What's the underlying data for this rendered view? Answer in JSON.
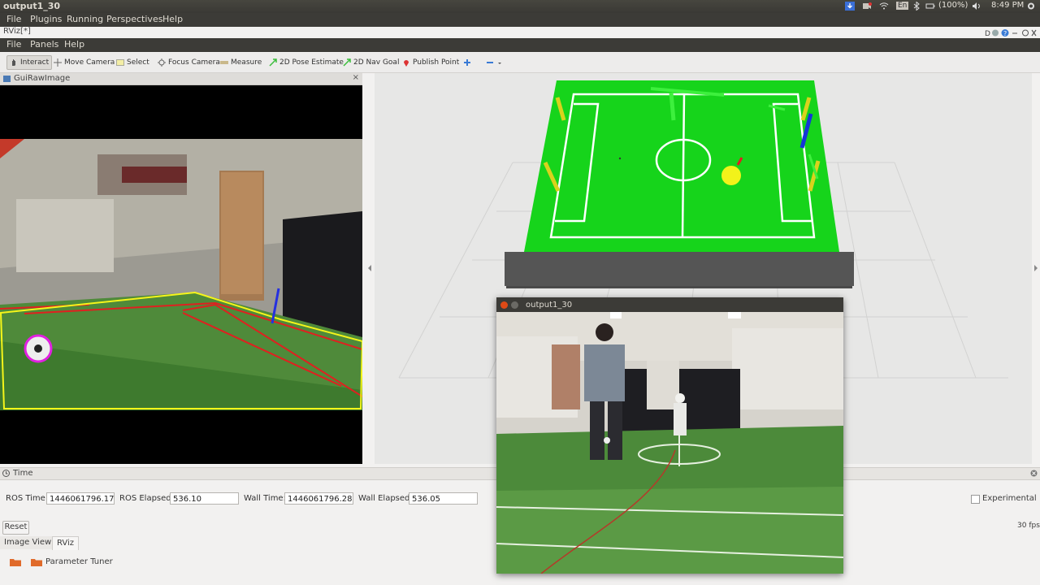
{
  "topbar": {
    "window_title": "output1_30",
    "keyboard_layout": "En",
    "battery": "(100%)",
    "clock": "8:49 PM"
  },
  "appmenu": [
    "File",
    "Plugins",
    "Running",
    "Perspectives",
    "Help"
  ],
  "rviz": {
    "title": "RViz[*]",
    "menu": [
      "File",
      "Panels",
      "Help"
    ],
    "toolbar": {
      "interact": "Interact",
      "move_camera": "Move Camera",
      "select": "Select",
      "focus_camera": "Focus Camera",
      "measure": "Measure",
      "pose_estimate": "2D Pose Estimate",
      "nav_goal": "2D Nav Goal",
      "publish_point": "Publish Point"
    }
  },
  "gui_panel": {
    "title": "GuiRawImage",
    "close": "×"
  },
  "time_panel": {
    "title": "Time",
    "ros_time_label": "ROS Time:",
    "ros_time": "1446061796.17",
    "ros_elapsed_label": "ROS Elapsed:",
    "ros_elapsed": "536.10",
    "wall_time_label": "Wall Time:",
    "wall_time": "1446061796.28",
    "wall_elapsed_label": "Wall Elapsed:",
    "wall_elapsed": "536.05",
    "experimental": "Experimental",
    "reset": "Reset",
    "fps": "30 fps"
  },
  "bottom_tabs": [
    "Image View",
    "RViz"
  ],
  "param_tuner": "Parameter Tuner",
  "output_window": {
    "title": "output1_30"
  },
  "colors": {
    "field_green": "#16d41b",
    "ball_yellow": "#f2f21a",
    "goal_yellow": "#d9d21d",
    "line_red": "#e02020",
    "detect_yellow": "#f5f51a"
  }
}
